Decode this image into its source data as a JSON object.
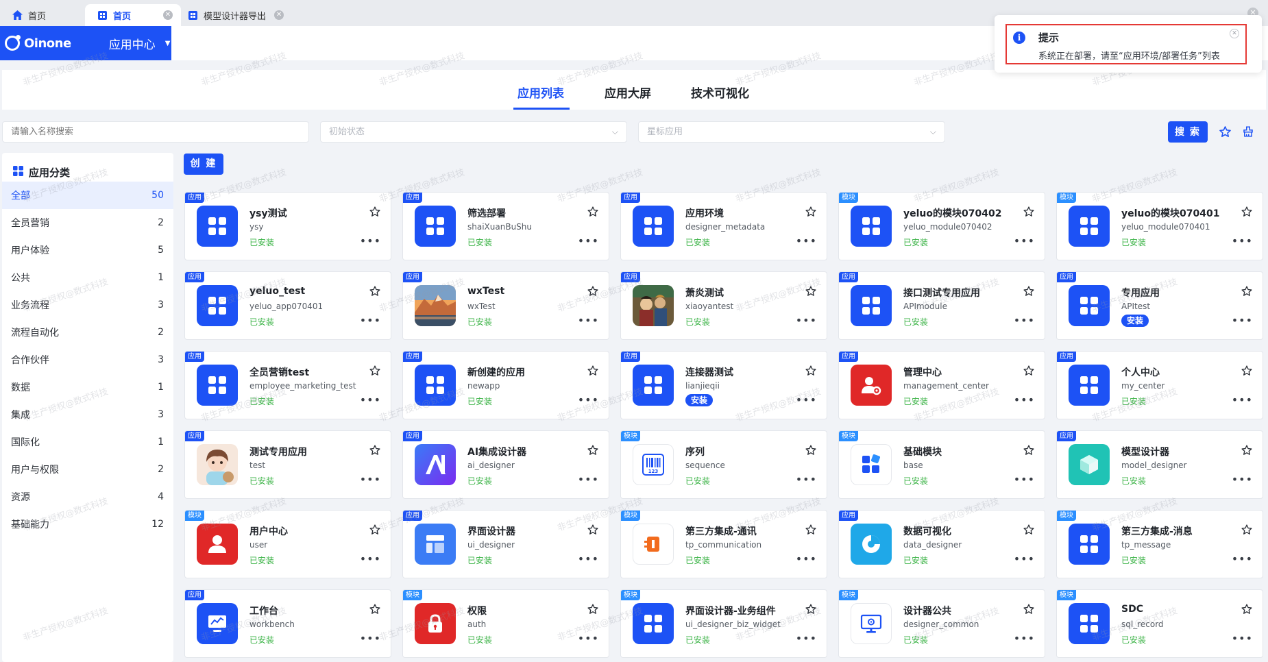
{
  "tabs": [
    {
      "label": "首页",
      "icon": "home-icon"
    },
    {
      "label": "首页",
      "icon": "grid-icon",
      "active": true
    },
    {
      "label": "模型设计器导出",
      "icon": "grid-icon"
    }
  ],
  "header": {
    "brand": "Oinone",
    "app_center": "应用中心"
  },
  "app_tabs": [
    "应用列表",
    "应用大屏",
    "技术可视化"
  ],
  "filters": {
    "search_placeholder": "请输入名称搜索",
    "status_placeholder": "初始状态",
    "star_placeholder": "星标应用",
    "search_label": "搜 索"
  },
  "sidebar": {
    "title": "应用分类",
    "items": [
      {
        "label": "全部",
        "count": "50"
      },
      {
        "label": "全员营销",
        "count": "2"
      },
      {
        "label": "用户体验",
        "count": "5"
      },
      {
        "label": "公共",
        "count": "1"
      },
      {
        "label": "业务流程",
        "count": "3"
      },
      {
        "label": "流程自动化",
        "count": "2"
      },
      {
        "label": "合作伙伴",
        "count": "3"
      },
      {
        "label": "数据",
        "count": "1"
      },
      {
        "label": "集成",
        "count": "3"
      },
      {
        "label": "国际化",
        "count": "1"
      },
      {
        "label": "用户与权限",
        "count": "2"
      },
      {
        "label": "资源",
        "count": "4"
      },
      {
        "label": "基础能力",
        "count": "12"
      }
    ]
  },
  "create_label": "创 建",
  "cards": [
    {
      "badge": "应用",
      "name": "ysy测试",
      "code": "ysy",
      "status": "已安装",
      "icon": "grid-app-icon",
      "color": "#1d52f5"
    },
    {
      "badge": "应用",
      "name": "筛选部署",
      "code": "shaiXuanBuShu",
      "status": "已安装",
      "icon": "grid-app-icon",
      "color": "#1d52f5"
    },
    {
      "badge": "应用",
      "name": "应用环境",
      "code": "designer_metadata",
      "status": "已安装",
      "icon": "grid-app-icon",
      "color": "#1d52f5"
    },
    {
      "badge": "模块",
      "name": "yeluo的模块070402",
      "code": "yeluo_module070402",
      "status": "已安装",
      "icon": "grid-app-icon",
      "color": "#1d52f5"
    },
    {
      "badge": "模块",
      "name": "yeluo的模块070401",
      "code": "yeluo_module070401",
      "status": "已安装",
      "icon": "grid-app-icon",
      "color": "#1d52f5"
    },
    {
      "badge": "应用",
      "name": "yeluo_test",
      "code": "yeluo_app070401",
      "status": "已安装",
      "icon": "grid-app-icon",
      "color": "#1d52f5"
    },
    {
      "badge": "应用",
      "name": "wxTest",
      "code": "wxTest",
      "status": "已安装",
      "icon": "mountain-photo-icon",
      "color": "#e07b3a"
    },
    {
      "badge": "应用",
      "name": "萧炎测试",
      "code": "xiaoyantest",
      "status": "已安装",
      "icon": "anime-photo-icon",
      "color": "#8a6a3e"
    },
    {
      "badge": "应用",
      "name": "接口测试专用应用",
      "code": "APImodule",
      "status": "已安装",
      "icon": "grid-app-icon",
      "color": "#1d52f5"
    },
    {
      "badge": "应用",
      "name": "专用应用",
      "code": "APItest",
      "status": "安装",
      "status_button": true,
      "icon": "grid-app-icon",
      "color": "#1d52f5"
    },
    {
      "badge": "应用",
      "name": "全员营销test",
      "code": "employee_marketing_test",
      "status": "已安装",
      "icon": "grid-app-icon",
      "color": "#1d52f5"
    },
    {
      "badge": "应用",
      "name": "新创建的应用",
      "code": "newapp",
      "status": "已安装",
      "icon": "grid-app-icon",
      "color": "#1d52f5"
    },
    {
      "badge": "应用",
      "name": "连接器测试",
      "code": "lianjieqii",
      "status": "安装",
      "status_button": true,
      "icon": "grid-app-icon",
      "color": "#1d52f5"
    },
    {
      "badge": "应用",
      "name": "管理中心",
      "code": "management_center",
      "status": "已安装",
      "icon": "user-gear-icon",
      "color": "#e02828"
    },
    {
      "badge": "应用",
      "name": "个人中心",
      "code": "my_center",
      "status": "已安装",
      "icon": "grid-app-icon",
      "color": "#1d52f5"
    },
    {
      "badge": "应用",
      "name": "测试专用应用",
      "code": "test",
      "status": "已安装",
      "icon": "girl-photo-icon",
      "color": "#f2b5a0"
    },
    {
      "badge": "应用",
      "name": "AI集成设计器",
      "code": "ai_designer",
      "status": "已安装",
      "icon": "ai-icon",
      "color": "#5b3cf0"
    },
    {
      "badge": "模块",
      "name": "序列",
      "code": "sequence",
      "status": "已安装",
      "icon": "barcode-icon",
      "color": "#ffffff"
    },
    {
      "badge": "模块",
      "name": "基础模块",
      "code": "base",
      "status": "已安装",
      "icon": "blocks-icon",
      "color": "#ffffff"
    },
    {
      "badge": "应用",
      "name": "模型设计器",
      "code": "model_designer",
      "status": "已安装",
      "icon": "cube-icon",
      "color": "#20c3b5"
    },
    {
      "badge": "模块",
      "name": "用户中心",
      "code": "user",
      "status": "已安装",
      "icon": "user-icon",
      "color": "#e02828"
    },
    {
      "badge": "应用",
      "name": "界面设计器",
      "code": "ui_designer",
      "status": "已安装",
      "icon": "layout-icon",
      "color": "#3b7cf5"
    },
    {
      "badge": "模块",
      "name": "第三方集成-通讯",
      "code": "tp_communication",
      "status": "已安装",
      "icon": "plug-icon",
      "color": "#ffffff"
    },
    {
      "badge": "应用",
      "name": "数据可视化",
      "code": "data_designer",
      "status": "已安装",
      "icon": "pie-chart-icon",
      "color": "#1fa8e8"
    },
    {
      "badge": "模块",
      "name": "第三方集成-消息",
      "code": "tp_message",
      "status": "已安装",
      "icon": "grid-app-icon",
      "color": "#1d52f5"
    },
    {
      "badge": "应用",
      "name": "工作台",
      "code": "workbench",
      "status": "已安装",
      "icon": "monitor-chart-icon",
      "color": "#1d52f5"
    },
    {
      "badge": "模块",
      "name": "权限",
      "code": "auth",
      "status": "已安装",
      "icon": "lock-icon",
      "color": "#e02828"
    },
    {
      "badge": "模块",
      "name": "界面设计器-业务组件",
      "code": "ui_designer_biz_widget",
      "status": "已安装",
      "icon": "grid-app-icon",
      "color": "#1d52f5"
    },
    {
      "badge": "模块",
      "name": "设计器公共",
      "code": "designer_common",
      "status": "已安装",
      "icon": "screen-gear-icon",
      "color": "#ffffff"
    },
    {
      "badge": "模块",
      "name": "SDC",
      "code": "sql_record",
      "status": "已安装",
      "icon": "grid-app-icon",
      "color": "#1d52f5"
    }
  ],
  "toast": {
    "title": "提示",
    "message": "系统正在部署，请至“应用环境/部署任务”列表"
  },
  "watermark": "非生产授权@数式科技"
}
